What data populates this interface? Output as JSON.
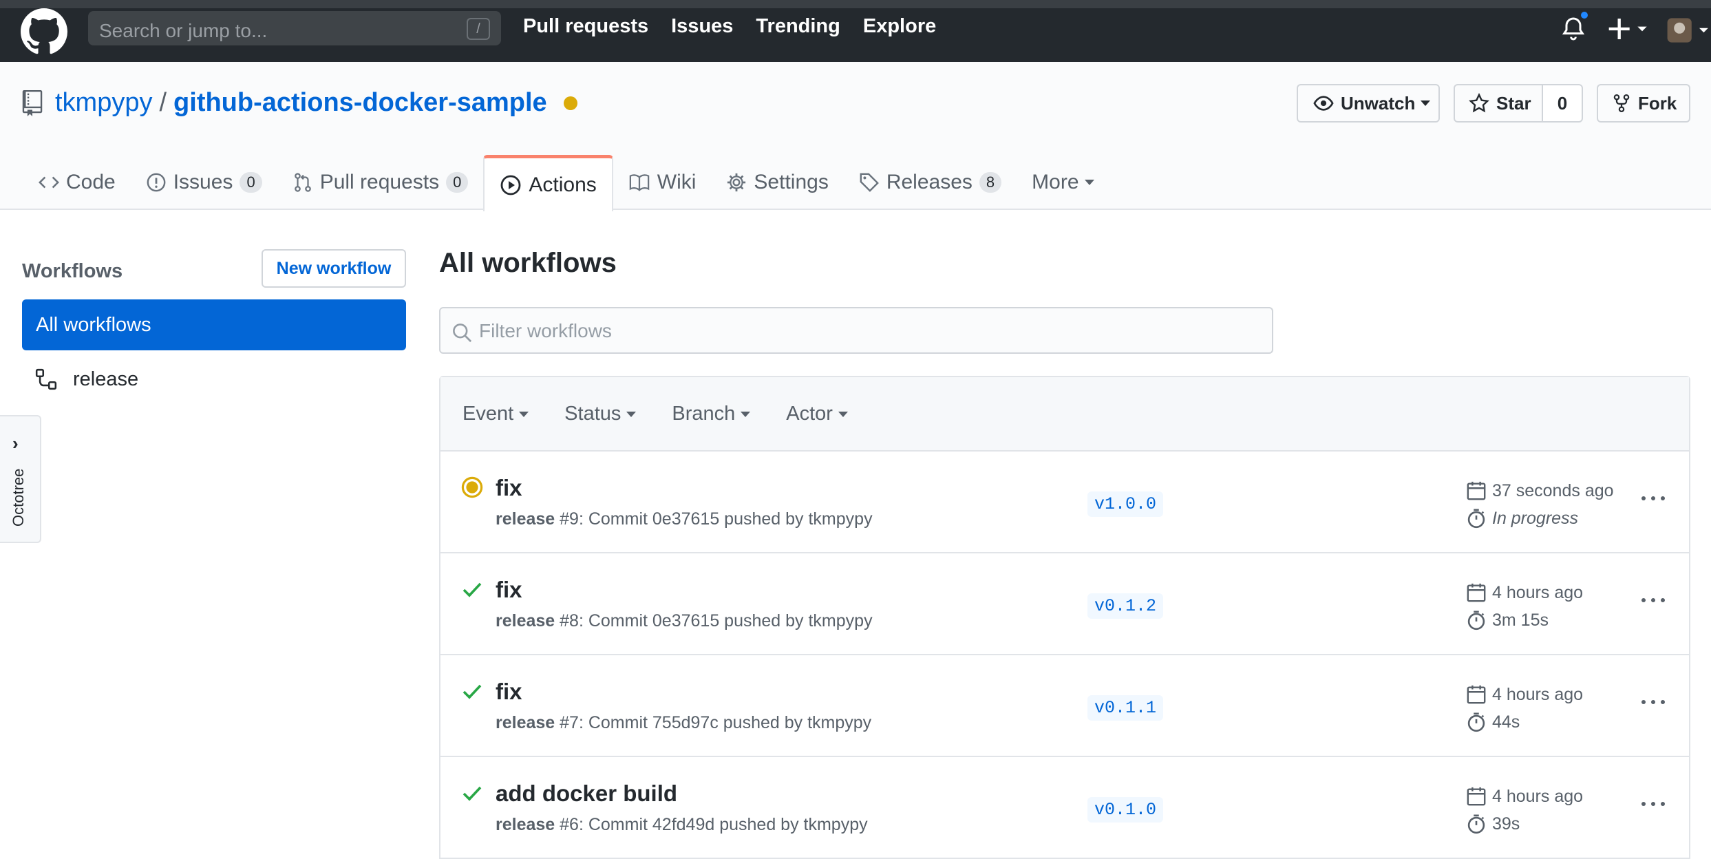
{
  "header": {
    "search_placeholder": "Search or jump to...",
    "search_shortcut": "/",
    "nav": [
      "Pull requests",
      "Issues",
      "Trending",
      "Explore"
    ]
  },
  "repo": {
    "owner": "tkmpypy",
    "separator": "/",
    "name": "github-actions-docker-sample",
    "unwatch_label": "Unwatch",
    "star_label": "Star",
    "star_count": "0",
    "fork_label": "Fork"
  },
  "tabs": [
    {
      "label": "Code",
      "icon": "code-icon"
    },
    {
      "label": "Issues",
      "count": "0",
      "icon": "issue-icon"
    },
    {
      "label": "Pull requests",
      "count": "0",
      "icon": "pull-request-icon"
    },
    {
      "label": "Actions",
      "icon": "play-icon",
      "active": true
    },
    {
      "label": "Wiki",
      "icon": "book-icon"
    },
    {
      "label": "Settings",
      "icon": "gear-icon"
    },
    {
      "label": "Releases",
      "count": "8",
      "icon": "tag-icon"
    },
    {
      "label": "More",
      "icon": "chevron-down-icon"
    }
  ],
  "sidebar": {
    "title": "Workflows",
    "new_workflow_label": "New workflow",
    "all_workflows_label": "All workflows",
    "items": [
      {
        "label": "release"
      }
    ]
  },
  "octotree": {
    "label": "Octotree"
  },
  "main": {
    "title": "All workflows",
    "filter_placeholder": "Filter workflows",
    "filters": [
      "Event",
      "Status",
      "Branch",
      "Actor"
    ]
  },
  "runs": [
    {
      "title": "fix",
      "workflow": "release",
      "sub": " #9: Commit 0e37615 pushed by tkmpypy",
      "branch": "v1.0.0",
      "time": "37 seconds ago",
      "duration": "In progress",
      "status": "in-progress"
    },
    {
      "title": "fix",
      "workflow": "release",
      "sub": " #8: Commit 0e37615 pushed by tkmpypy",
      "branch": "v0.1.2",
      "time": "4 hours ago",
      "duration": "3m 15s",
      "status": "success"
    },
    {
      "title": "fix",
      "workflow": "release",
      "sub": " #7: Commit 755d97c pushed by tkmpypy",
      "branch": "v0.1.1",
      "time": "4 hours ago",
      "duration": "44s",
      "status": "success"
    },
    {
      "title": "add docker build",
      "workflow": "release",
      "sub": " #6: Commit 42fd49d pushed by tkmpypy",
      "branch": "v0.1.0",
      "time": "4 hours ago",
      "duration": "39s",
      "status": "success"
    }
  ],
  "colors": {
    "accent": "#0366d6",
    "success": "#28a745",
    "pending": "#dbab09",
    "tab_active": "#f9826c"
  }
}
